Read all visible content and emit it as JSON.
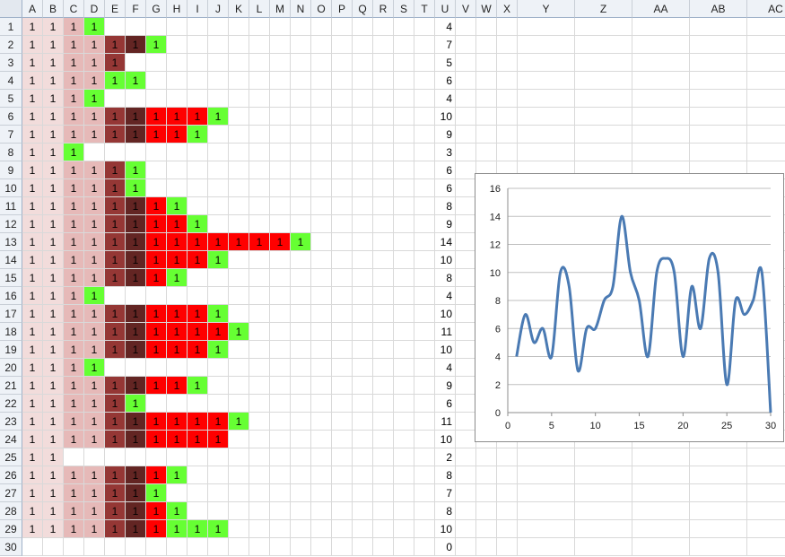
{
  "columns": [
    "A",
    "B",
    "C",
    "D",
    "E",
    "F",
    "G",
    "H",
    "I",
    "J",
    "K",
    "L",
    "M",
    "N",
    "O",
    "P",
    "Q",
    "R",
    "S",
    "T",
    "U",
    "V",
    "W",
    "X",
    "Y",
    "Z",
    "AA",
    "AB",
    "AC"
  ],
  "cell_value": "1",
  "colors": {
    "A": "#f2dcdb",
    "B": "#f2dcdb",
    "C": "#e6b9b8",
    "D": "#e6b9b8",
    "E": "#953735",
    "F": "#632523",
    "red": "#ff0000",
    "end": "#66ff33"
  },
  "rows": [
    {
      "num": "1",
      "end_col": 3,
      "total": "4"
    },
    {
      "num": "2",
      "end_col": 6,
      "total": "7"
    },
    {
      "num": "3",
      "end_col": 4,
      "total": "5"
    },
    {
      "num": "4",
      "end_col": 5,
      "total": "6"
    },
    {
      "num": "5",
      "end_col": 3,
      "total": "4"
    },
    {
      "num": "6",
      "end_col": 9,
      "total": "10"
    },
    {
      "num": "7",
      "end_col": 8,
      "total": "9"
    },
    {
      "num": "8",
      "end_col": 2,
      "total": "3"
    },
    {
      "num": "9",
      "end_col": 5,
      "total": "6"
    },
    {
      "num": "10",
      "end_col": 5,
      "total": "6"
    },
    {
      "num": "11",
      "end_col": 7,
      "total": "8"
    },
    {
      "num": "12",
      "end_col": 8,
      "total": "9"
    },
    {
      "num": "13",
      "end_col": 13,
      "total": "14"
    },
    {
      "num": "14",
      "end_col": 9,
      "total": "10"
    },
    {
      "num": "15",
      "end_col": 7,
      "total": "8"
    },
    {
      "num": "16",
      "end_col": 3,
      "total": "4"
    },
    {
      "num": "17",
      "end_col": 9,
      "total": "10"
    },
    {
      "num": "18",
      "end_col": 10,
      "total": "11"
    },
    {
      "num": "19",
      "end_col": 9,
      "total": "10"
    },
    {
      "num": "20",
      "end_col": 3,
      "total": "4"
    },
    {
      "num": "21",
      "end_col": 8,
      "total": "9"
    },
    {
      "num": "22",
      "end_col": 5,
      "total": "6"
    },
    {
      "num": "23",
      "end_col": 10,
      "total": "11"
    },
    {
      "num": "24",
      "end_col": 9,
      "total": "10"
    },
    {
      "num": "25",
      "end_col": 1,
      "total": "2"
    },
    {
      "num": "26",
      "end_col": 7,
      "total": "8"
    },
    {
      "num": "27",
      "end_col": 6,
      "total": "7"
    },
    {
      "num": "28",
      "end_col": 7,
      "total": "8"
    },
    {
      "num": "29",
      "end_col": 9,
      "total": "10"
    },
    {
      "num": "30",
      "end_col": -1,
      "total": "0"
    }
  ],
  "row_highlights": {
    "2": {
      "E": "#953735",
      "F": "#632523",
      "G": "#66ff33"
    },
    "3": {
      "E": "#953735"
    },
    "4": {
      "E": "#66ff33",
      "F": "#66ff33"
    },
    "5": {
      "D": "#66ff33"
    },
    "8": {
      "C": "#66ff33"
    },
    "9": {
      "F": "#66ff33"
    },
    "16": {
      "D": "#66ff33"
    },
    "20": {
      "D": "#66ff33"
    },
    "22": {
      "F": "#66ff33"
    },
    "24": {
      "J": "#ff0000"
    },
    "25": {
      "A": "#f2dcdb",
      "B": "#f2dcdb"
    },
    "27": {
      "G": "#66ff33"
    },
    "29": {
      "G": "#ff0000",
      "H": "#66ff33",
      "I": "#66ff33",
      "J": "#66ff33"
    }
  },
  "chart_data": {
    "type": "line",
    "title": "",
    "xlabel": "",
    "ylabel": "",
    "x": [
      1,
      2,
      3,
      4,
      5,
      6,
      7,
      8,
      9,
      10,
      11,
      12,
      13,
      14,
      15,
      16,
      17,
      18,
      19,
      20,
      21,
      22,
      23,
      24,
      25,
      26,
      27,
      28,
      29,
      30
    ],
    "series": [
      {
        "name": "",
        "values": [
          4,
          7,
          5,
          6,
          4,
          10,
          9,
          3,
          6,
          6,
          8,
          9,
          14,
          10,
          8,
          4,
          10,
          11,
          10,
          4,
          9,
          6,
          11,
          10,
          2,
          8,
          7,
          8,
          10,
          0
        ],
        "color": "#4a7ab3"
      }
    ],
    "xlim": [
      0,
      30
    ],
    "ylim": [
      0,
      16
    ],
    "x_ticks": [
      "0",
      "5",
      "10",
      "15",
      "20",
      "25",
      "30"
    ],
    "y_ticks": [
      "0",
      "2",
      "4",
      "6",
      "8",
      "10",
      "12",
      "14",
      "16"
    ],
    "grid": true,
    "smooth": true,
    "legend": "none"
  }
}
